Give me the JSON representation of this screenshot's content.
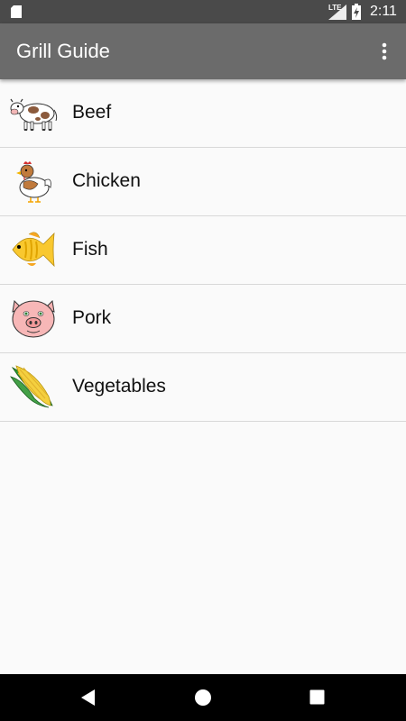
{
  "status_bar": {
    "network": "LTE",
    "time": "2:11",
    "icons": [
      "sd-card-icon",
      "signal-icon",
      "battery-charging-icon"
    ]
  },
  "app_bar": {
    "title": "Grill Guide",
    "menu_icon": "more-vertical-icon"
  },
  "list": {
    "items": [
      {
        "label": "Beef",
        "icon": "cow-icon"
      },
      {
        "label": "Chicken",
        "icon": "chicken-icon"
      },
      {
        "label": "Fish",
        "icon": "fish-icon"
      },
      {
        "label": "Pork",
        "icon": "pig-icon"
      },
      {
        "label": "Vegetables",
        "icon": "corn-icon"
      }
    ]
  },
  "nav_bar": {
    "icons": [
      "back-icon",
      "home-icon",
      "recents-icon"
    ]
  },
  "colors": {
    "status_bar": "#4a4a4a",
    "app_bar": "#6b6b6b",
    "background": "#fafafa",
    "divider": "#d8d8d8"
  }
}
